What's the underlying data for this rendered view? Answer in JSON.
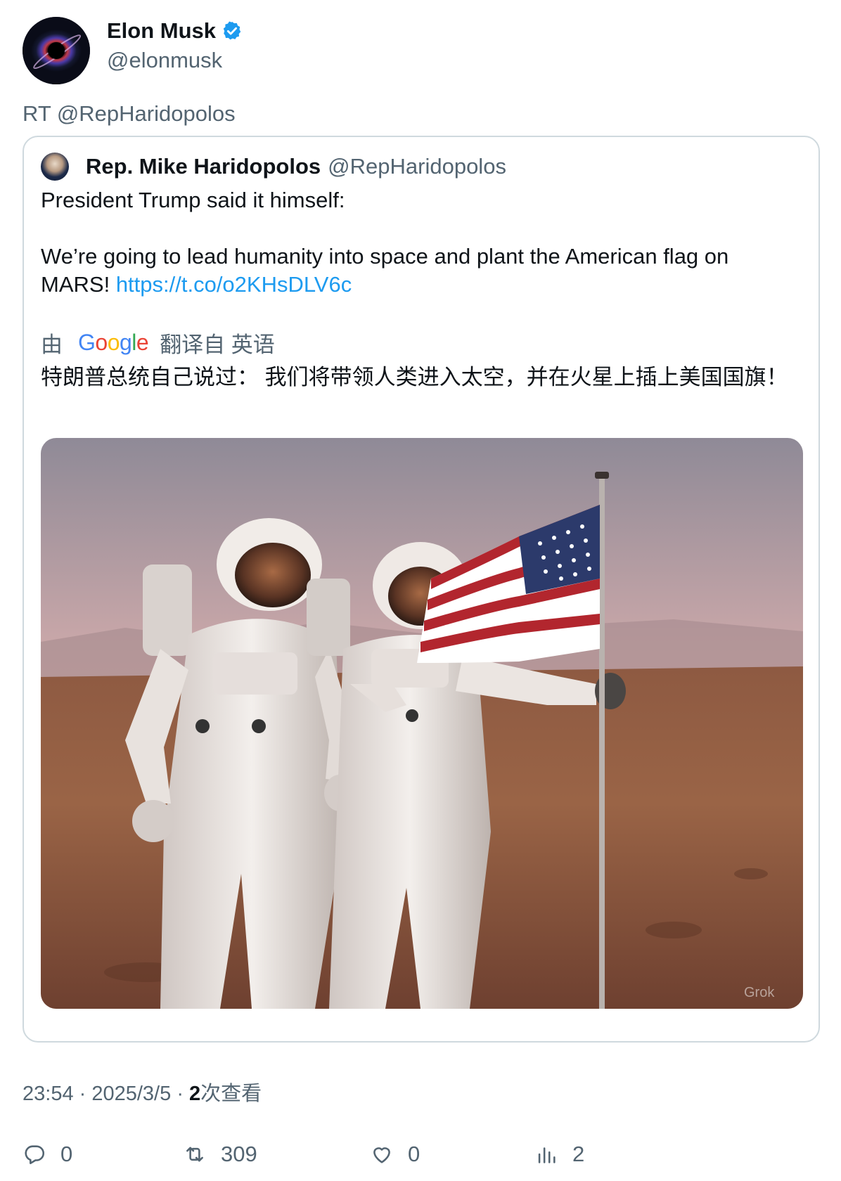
{
  "author": {
    "name": "Elon Musk",
    "handle": "@elonmusk"
  },
  "retweet_text": "RT @RepHaridopolos",
  "quoted": {
    "name": "Rep. Mike Haridopolos",
    "handle": "@RepHaridopolos",
    "line1": "President Trump said it himself:",
    "line2": "We’re going to lead humanity into space and plant the American flag on MARS!",
    "link": "https://t.co/o2KHsDLV6c",
    "translate_prefix": "由",
    "translate_suffix": "翻译自 英语",
    "translated_text": "特朗普总统自己说过： 我们将带领人类进入太空，并在火星上插上美国国旗！",
    "media_watermark": "Grok"
  },
  "meta": {
    "time": "23:54",
    "date": "2025/3/5",
    "views_count": "2",
    "views_label": "次查看"
  },
  "actions": {
    "reply_count": "0",
    "retweet_count": "309",
    "like_count": "0",
    "views_count": "2"
  },
  "colors": {
    "accent": "#1d9bf0",
    "secondary_text": "#536471",
    "border": "#cfd9de"
  },
  "icons": [
    "verified-badge-icon",
    "reply-icon",
    "retweet-icon",
    "like-icon",
    "views-icon"
  ]
}
